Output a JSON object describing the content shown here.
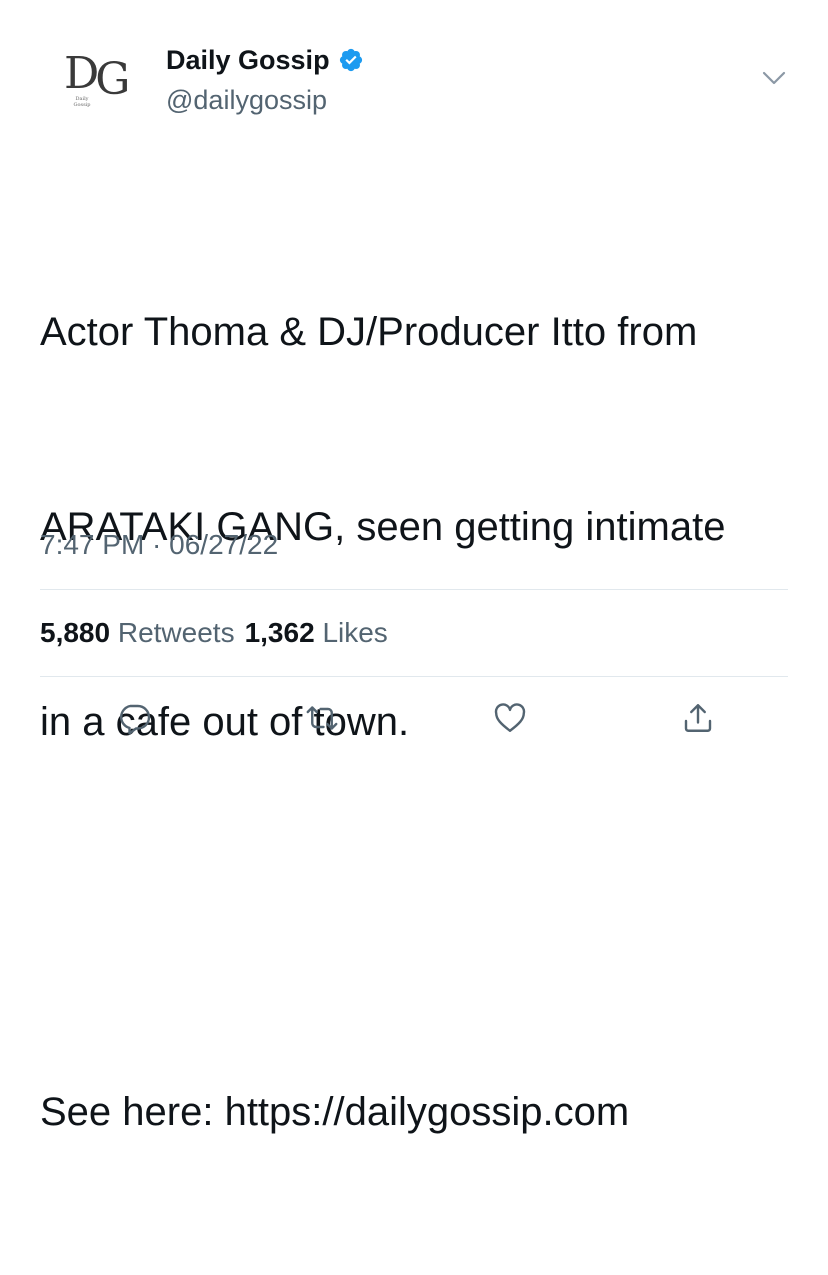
{
  "author": {
    "logo_text": "DG",
    "logo_subtext": "Daily Gossip",
    "name": "Daily Gossip",
    "handle": "@dailygossip",
    "verified": true
  },
  "tweet": {
    "lines": [
      "Actor Thoma & DJ/Producer Itto from",
      "ARATAKI GANG, seen getting intimate",
      "in a cafe out of town.",
      "",
      "See here: https://dailygossip.com"
    ],
    "timestamp": "7:47 PM · 06/27/22"
  },
  "stats": {
    "retweets_count": "5,880",
    "retweets_label": "Retweets",
    "likes_count": "1,362",
    "likes_label": "Likes"
  },
  "colors": {
    "text_primary": "#0f1419",
    "text_secondary": "#536471",
    "verified_blue": "#1d9bf0",
    "divider": "#e1e8ed"
  },
  "icons": {
    "menu": "chevron-down-icon",
    "reply": "reply-icon",
    "retweet": "retweet-icon",
    "like": "heart-icon",
    "share": "share-icon"
  }
}
